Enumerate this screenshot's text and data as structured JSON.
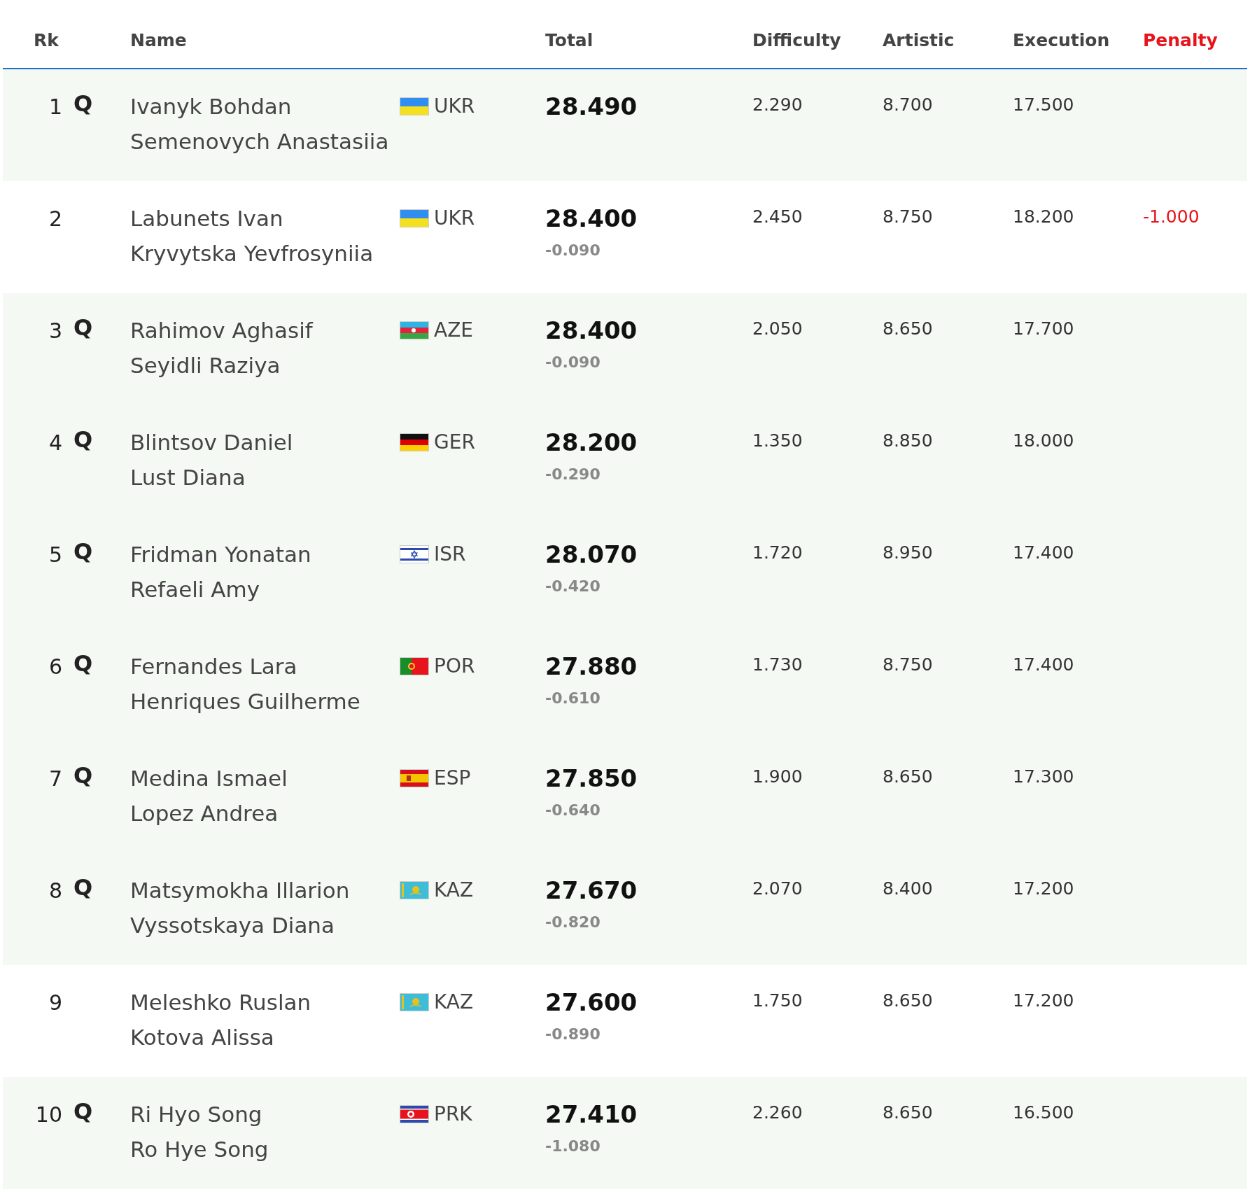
{
  "columns": [
    "Rk",
    "Name",
    "Total",
    "Difficulty",
    "Artistic",
    "Execution",
    "Penalty"
  ],
  "rows": [
    {
      "rank": "1",
      "mark": "Q",
      "names": [
        "Ivanyk Bohdan",
        "Semenovych Anastasiia"
      ],
      "flag": {
        "kind": "ukraine"
      },
      "country": "UKR",
      "total": "28.490",
      "difficulty": "2.290",
      "artistic": "8.700",
      "execution": "17.500"
    },
    {
      "rank": "2",
      "names": [
        "Labunets Ivan",
        "Kryvytska Yevfrosyniia"
      ],
      "flag": {
        "kind": "ukraine"
      },
      "country": "UKR",
      "total": "28.400",
      "behind": "-0.090",
      "difficulty": "2.450",
      "artistic": "8.750",
      "execution": "18.200",
      "penalty": "-1.000"
    },
    {
      "rank": "3",
      "mark": "Q",
      "names": [
        "Rahimov Aghasif",
        "Seyidli Raziya"
      ],
      "flag": {
        "kind": "azerbaijan"
      },
      "country": "AZE",
      "total": "28.400",
      "behind": "-0.090",
      "difficulty": "2.050",
      "artistic": "8.650",
      "execution": "17.700"
    },
    {
      "rank": "4",
      "mark": "Q",
      "names": [
        "Blintsov Daniel",
        "Lust Diana"
      ],
      "flag": {
        "kind": "germany"
      },
      "country": "GER",
      "total": "28.200",
      "behind": "-0.290",
      "difficulty": "1.350",
      "artistic": "8.850",
      "execution": "18.000"
    },
    {
      "rank": "5",
      "mark": "Q",
      "names": [
        "Fridman Yonatan",
        "Refaeli Amy"
      ],
      "flag": {
        "kind": "israel"
      },
      "country": "ISR",
      "total": "28.070",
      "behind": "-0.420",
      "difficulty": "1.720",
      "artistic": "8.950",
      "execution": "17.400"
    },
    {
      "rank": "6",
      "mark": "Q",
      "names": [
        "Fernandes Lara",
        "Henriques Guilherme"
      ],
      "flag": {
        "kind": "portugal"
      },
      "country": "POR",
      "total": "27.880",
      "behind": "-0.610",
      "difficulty": "1.730",
      "artistic": "8.750",
      "execution": "17.400"
    },
    {
      "rank": "7",
      "mark": "Q",
      "names": [
        "Medina Ismael",
        "Lopez Andrea"
      ],
      "flag": {
        "kind": "spain"
      },
      "country": "ESP",
      "total": "27.850",
      "behind": "-0.640",
      "difficulty": "1.900",
      "artistic": "8.650",
      "execution": "17.300"
    },
    {
      "rank": "8",
      "mark": "Q",
      "names": [
        "Matsymokha Illarion",
        "Vyssotskaya Diana"
      ],
      "flag": {
        "kind": "kazakhstan"
      },
      "country": "KAZ",
      "total": "27.670",
      "behind": "-0.820",
      "difficulty": "2.070",
      "artistic": "8.400",
      "execution": "17.200"
    },
    {
      "rank": "9",
      "names": [
        "Meleshko Ruslan",
        "Kotova Alissa"
      ],
      "flag": {
        "kind": "kazakhstan"
      },
      "country": "KAZ",
      "total": "27.600",
      "behind": "-0.890",
      "difficulty": "1.750",
      "artistic": "8.650",
      "execution": "17.200"
    },
    {
      "rank": "10",
      "mark": "Q",
      "names": [
        "Ri Hyo Song",
        "Ro Hye Song"
      ],
      "flag": {
        "kind": "north-korea"
      },
      "country": "PRK",
      "total": "27.410",
      "behind": "-1.080",
      "difficulty": "2.260",
      "artistic": "8.650",
      "execution": "16.500"
    }
  ]
}
